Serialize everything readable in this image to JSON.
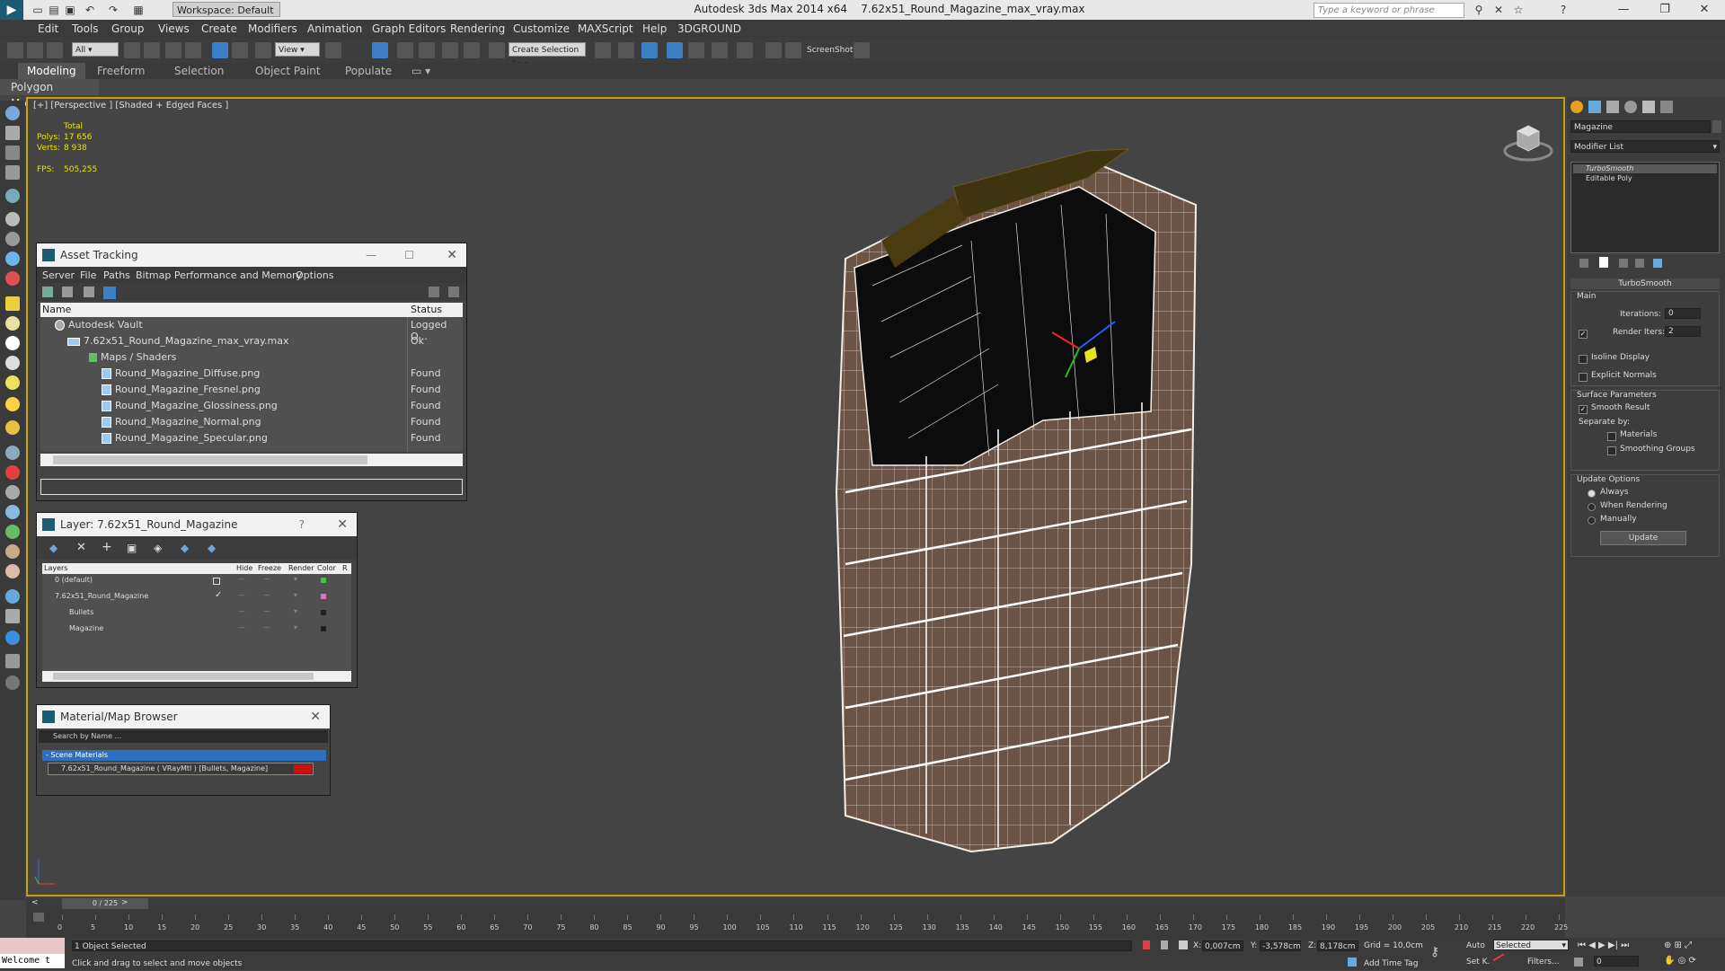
{
  "titlebar": {
    "app_title": "Autodesk 3ds Max  2014 x64",
    "file_name": "7.62x51_Round_Magazine_max_vray.max",
    "workspace": "Workspace: Default",
    "search_placeholder": "Type a keyword or phrase"
  },
  "menubar": {
    "items": [
      "Edit",
      "Tools",
      "Group",
      "Views",
      "Create",
      "Modifiers",
      "Animation",
      "Graph Editors",
      "Rendering",
      "Customize",
      "MAXScript",
      "Help",
      "3DGROUND"
    ]
  },
  "toolbar": {
    "filter": "All",
    "view": "View",
    "selection_set": "Create Selection Se",
    "screenshot": "ScreenShot"
  },
  "ribbon": {
    "tabs": [
      "Modeling",
      "Freeform",
      "Selection",
      "Object Paint",
      "Populate"
    ],
    "sub": "Polygon Modeling"
  },
  "viewport": {
    "label": "[+] [Perspective ] [Shaded + Edged Faces ]",
    "stats": {
      "total": "Total",
      "polys_label": "Polys:",
      "polys": "17 656",
      "verts_label": "Verts:",
      "verts": "8 938",
      "fps_label": "FPS:",
      "fps": "505,255"
    },
    "wire_color": "#f0e8e0",
    "body_color": "#6b5446"
  },
  "asset_tracking": {
    "title": "Asset Tracking",
    "menu": [
      "Server",
      "File",
      "Paths",
      "Bitmap Performance and Memory",
      "Options"
    ],
    "columns": [
      "Name",
      "Status"
    ],
    "rows": [
      {
        "name": "Autodesk Vault",
        "status": "Logged O..."
      },
      {
        "name": "7.62x51_Round_Magazine_max_vray.max",
        "status": "Ok"
      },
      {
        "name": "Maps / Shaders",
        "status": ""
      },
      {
        "name": "Round_Magazine_Diffuse.png",
        "status": "Found"
      },
      {
        "name": "Round_Magazine_Fresnel.png",
        "status": "Found"
      },
      {
        "name": "Round_Magazine_Glossiness.png",
        "status": "Found"
      },
      {
        "name": "Round_Magazine_Normal.png",
        "status": "Found"
      },
      {
        "name": "Round_Magazine_Specular.png",
        "status": "Found"
      }
    ]
  },
  "layer_window": {
    "title": "Layer: 7.62x51_Round_Magazine",
    "help": "?",
    "columns": [
      "Layers",
      "Hide",
      "Freeze",
      "Render",
      "Color",
      "R"
    ],
    "rows": [
      {
        "name": "0 (default)",
        "color": "#33cc33"
      },
      {
        "name": "7.62x51_Round_Magazine",
        "color": "#e070c0"
      },
      {
        "name": "Bullets",
        "color": "#222222"
      },
      {
        "name": "Magazine",
        "color": "#222222"
      }
    ]
  },
  "material_browser": {
    "title": "Material/Map Browser",
    "search": "Search by Name ...",
    "group": "- Scene Materials",
    "material": "7.62x51_Round_Magazine  ( VRayMtl )  [Bullets, Magazine]",
    "material_swatch": "#cc1111"
  },
  "command_panel": {
    "object_name": "Magazine",
    "modifier_list": "Modifier List",
    "stack": [
      "TurboSmooth",
      "Editable Poly"
    ],
    "rollout": "TurboSmooth",
    "main": "Main",
    "iterations_label": "Iterations:",
    "iterations": "0",
    "render_iters_label": "Render Iters:",
    "render_iters": "2",
    "isoline": "Isoline Display",
    "explicit": "Explicit Normals",
    "surface": "Surface Parameters",
    "smooth": "Smooth Result",
    "separate": "Separate by:",
    "materials": "Materials",
    "smoothing_groups": "Smoothing Groups",
    "update_options": "Update Options",
    "always": "Always",
    "when_rendering": "When Rendering",
    "manually": "Manually",
    "update_button": "Update"
  },
  "timeline": {
    "frame": "0 / 225",
    "ticks": [
      0,
      5,
      10,
      15,
      20,
      25,
      30,
      35,
      40,
      45,
      50,
      55,
      60,
      65,
      70,
      75,
      80,
      85,
      90,
      95,
      100,
      105,
      110,
      115,
      120,
      125,
      130,
      135,
      140,
      145,
      150,
      155,
      160,
      165,
      170,
      175,
      180,
      185,
      190,
      195,
      200,
      205,
      210,
      215,
      220,
      225
    ]
  },
  "statusbar": {
    "listener": "Welcome t",
    "selected": "1 Object Selected",
    "prompt": "Click and drag to select and move objects",
    "x_label": "X:",
    "x": "0,007cm",
    "y_label": "Y:",
    "y": "-3,578cm",
    "z_label": "Z:",
    "z": "8,178cm",
    "grid": "Grid = 10,0cm",
    "add_time_tag": "Add Time Tag",
    "auto": "Auto",
    "selected_dd": "Selected",
    "setk": "Set K.",
    "filters": "Filters...",
    "frame_field": "0"
  }
}
